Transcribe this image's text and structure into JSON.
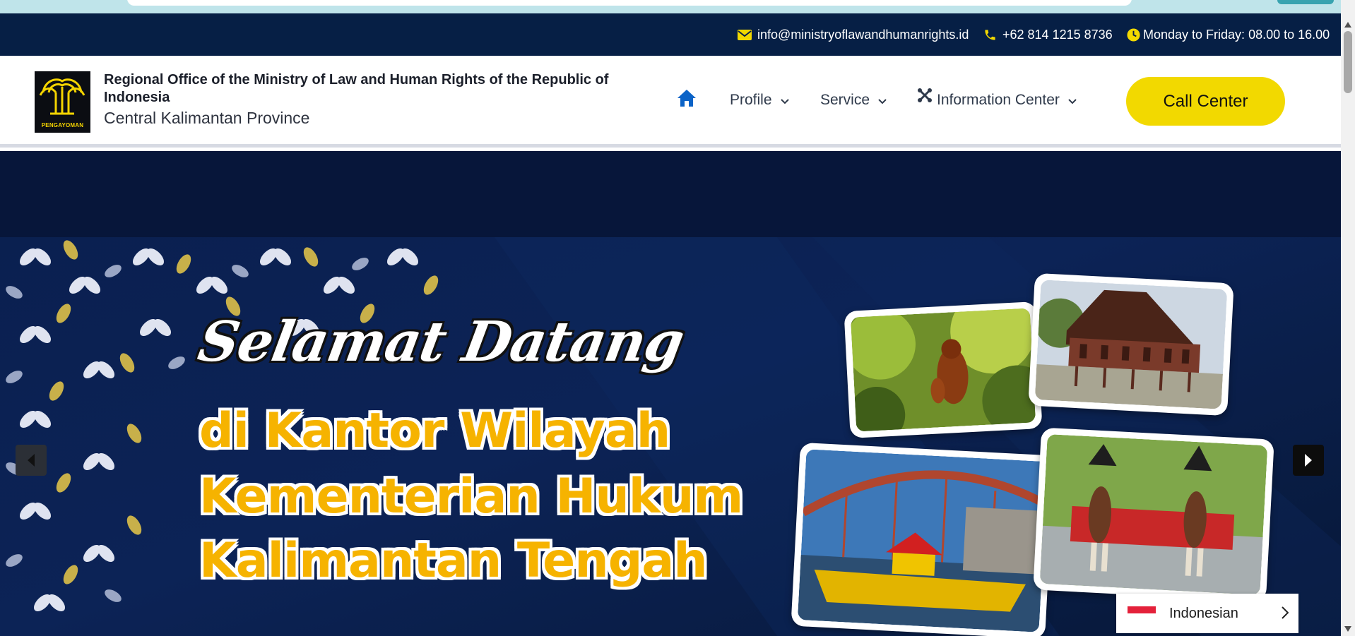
{
  "contact": {
    "email": "info@ministryoflawandhumanrights.id",
    "phone": "+62 814 1215 8736",
    "hours": "Monday to Friday: 08.00 to 16.00",
    "icons": [
      "envelope-icon",
      "phone-icon",
      "clock-icon"
    ],
    "icon_color": "#f2d900"
  },
  "header": {
    "logo_caption": "PENGAYOMAN",
    "title": "Regional Office of the Ministry of Law and Human Rights of the Republic of Indonesia",
    "subtitle": "Central Kalimantan Province"
  },
  "nav": {
    "home_icon": "home-icon",
    "items": [
      {
        "label": "Profile"
      },
      {
        "label": "Service"
      },
      {
        "label": "Information Center"
      }
    ],
    "call_center": "Call Center"
  },
  "hero": {
    "script_line": "Selamat Datang",
    "lines": [
      "di Kantor Wilayah",
      "Kementerian Hukum",
      "Kalimantan Tengah"
    ],
    "photos": [
      "orangutan-photo",
      "traditional-house-photo",
      "river-boat-photo",
      "dayak-dance-photo"
    ]
  },
  "language": {
    "current": "Indonesian"
  },
  "colors": {
    "navy": "#061f45",
    "accent_yellow": "#f2d900",
    "hero_gold": "#f6b300",
    "nav_icon_blue": "#0b63c7"
  }
}
